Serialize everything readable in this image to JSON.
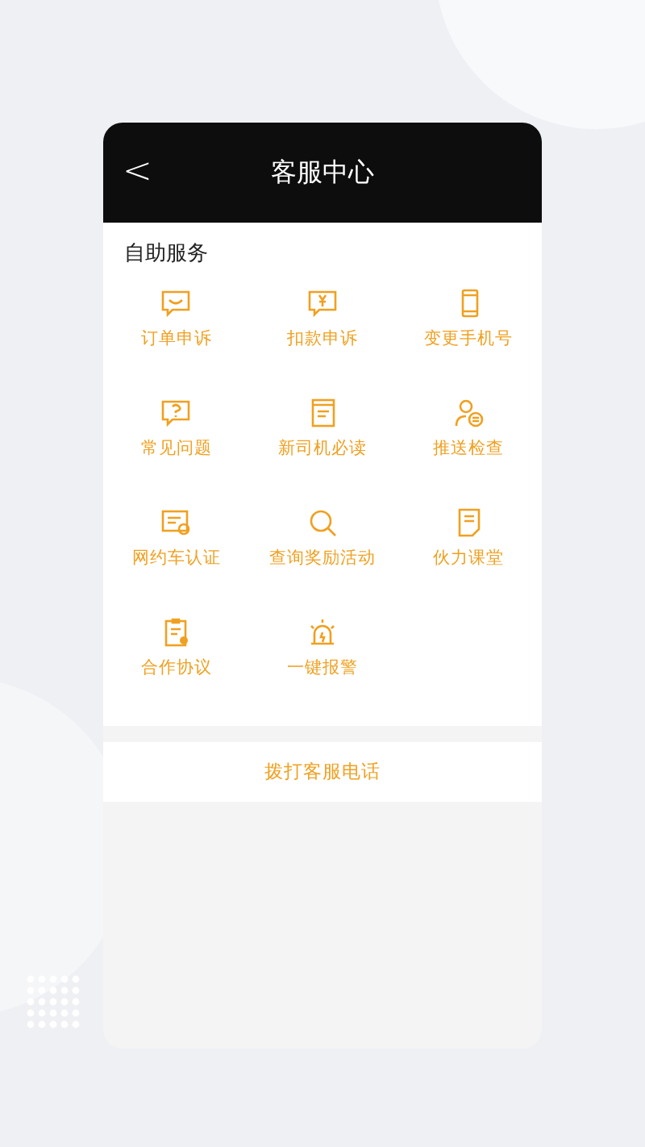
{
  "header": {
    "back": "<",
    "title": "客服中心"
  },
  "section": {
    "title": "自助服务"
  },
  "services": [
    {
      "label": "订单申诉",
      "kind": "chat"
    },
    {
      "label": "扣款申诉",
      "kind": "money"
    },
    {
      "label": "变更手机号",
      "kind": "phone"
    },
    {
      "label": "常见问题",
      "kind": "question"
    },
    {
      "label": "新司机必读",
      "kind": "book"
    },
    {
      "label": "推送检查",
      "kind": "person"
    },
    {
      "label": "网约车认证",
      "kind": "cert"
    },
    {
      "label": "查询奖励活动",
      "kind": "search"
    },
    {
      "label": "伙力课堂",
      "kind": "doc"
    },
    {
      "label": "合作协议",
      "kind": "clipboard"
    },
    {
      "label": "一键报警",
      "kind": "alarm"
    }
  ],
  "call_button": "拨打客服电话"
}
